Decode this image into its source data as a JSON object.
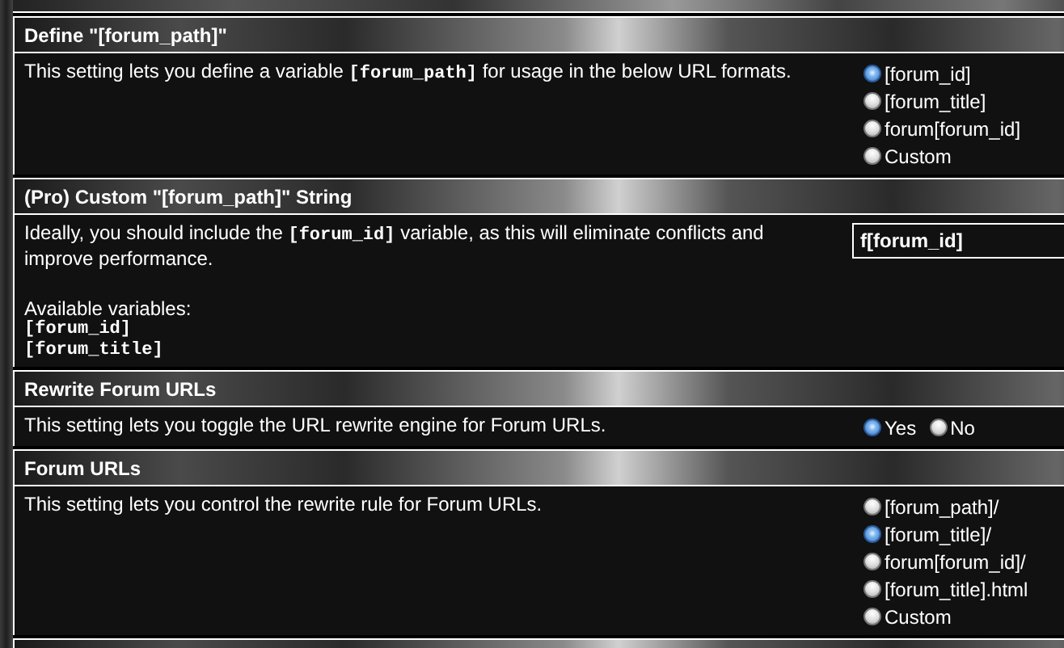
{
  "sections": [
    {
      "title": "Define \"[forum_path]\"",
      "description": [
        {
          "kind": "text",
          "text": "This setting lets you define a variable "
        },
        {
          "kind": "code",
          "text": "[forum_path]"
        },
        {
          "kind": "text",
          "text": " for usage in the below URL formats."
        }
      ],
      "control": {
        "kind": "radio_column",
        "options": [
          {
            "label": "[forum_id]",
            "selected": true
          },
          {
            "label": "[forum_title]",
            "selected": false
          },
          {
            "label": "forum[forum_id]",
            "selected": false
          },
          {
            "label": "Custom",
            "selected": false
          }
        ]
      }
    },
    {
      "title": "(Pro) Custom \"[forum_path]\" String",
      "description": [
        {
          "kind": "text",
          "text": "Ideally, you should include the "
        },
        {
          "kind": "code",
          "text": "[forum_id]"
        },
        {
          "kind": "text",
          "text": " variable, as this will eliminate conflicts and improve performance."
        }
      ],
      "variables_label": "Available variables:",
      "variables": [
        "[forum_id]",
        "[forum_title]"
      ],
      "control": {
        "kind": "text",
        "value": "f[forum_id]"
      }
    },
    {
      "title": "Rewrite Forum URLs",
      "description": [
        {
          "kind": "text",
          "text": "This setting lets you toggle the URL rewrite engine for Forum URLs."
        }
      ],
      "control": {
        "kind": "radio_row",
        "options": [
          {
            "label": "Yes",
            "selected": true
          },
          {
            "label": "No",
            "selected": false
          }
        ]
      }
    },
    {
      "title": "Forum URLs",
      "description": [
        {
          "kind": "text",
          "text": "This setting lets you control the rewrite rule for Forum URLs."
        }
      ],
      "control": {
        "kind": "radio_column",
        "options": [
          {
            "label": "[forum_path]/",
            "selected": false
          },
          {
            "label": "[forum_title]/",
            "selected": true
          },
          {
            "label": "forum[forum_id]/",
            "selected": false
          },
          {
            "label": "[forum_title].html",
            "selected": false
          },
          {
            "label": "Custom",
            "selected": false
          }
        ]
      }
    }
  ]
}
